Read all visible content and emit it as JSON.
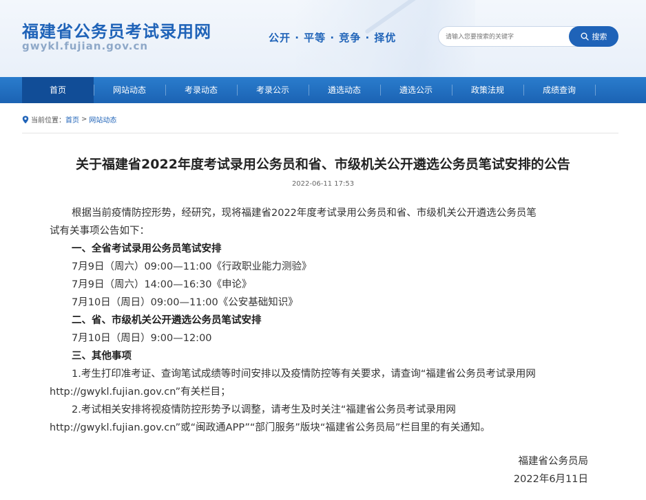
{
  "header": {
    "site_title": "福建省公务员考试录用网",
    "site_url": "gwykl.fujian.gov.cn",
    "slogan": "公开 · 平等 · 竞争 · 择优",
    "search": {
      "placeholder": "请输入您要搜索的关键字",
      "button_label": "搜索"
    }
  },
  "nav": {
    "items": [
      {
        "label": "首页",
        "active": true
      },
      {
        "label": "网站动态"
      },
      {
        "label": "考录动态"
      },
      {
        "label": "考录公示"
      },
      {
        "label": "遴选动态"
      },
      {
        "label": "遴选公示"
      },
      {
        "label": "政策法规"
      },
      {
        "label": "成绩查询"
      }
    ]
  },
  "breadcrumb": {
    "prefix": "当前位置：",
    "home": "首页",
    "separator": ">",
    "current": "网站动态"
  },
  "article": {
    "title": "关于福建省2022年度考试录用公务员和省、市级机关公开遴选公务员笔试安排的公告",
    "date": "2022-06-11 17:53",
    "intro_line1": "根据当前疫情防控形势，经研究，现将福建省2022年度考试录用公务员和省、市级机关公开遴选公务员笔",
    "intro_line2": "试有关事项公告如下：",
    "section1_heading": "一、全省考试录用公务员笔试安排",
    "section1_items": [
      "7月9日（周六）09:00—11:00《行政职业能力测验》",
      "7月9日（周六）14:00—16:30《申论》",
      "7月10日（周日）09:00—11:00《公安基础知识》"
    ],
    "section2_heading": "二、省、市级机关公开遴选公务员笔试安排",
    "section2_items": [
      "7月10日（周日）9:00—12:00"
    ],
    "section3_heading": "三、其他事项",
    "note1_line1": "1.考生打印准考证、查询笔试成绩等时间安排以及疫情防控等有关要求，请查询“福建省公务员考试录用网",
    "note1_line2": "http://gwykl.fujian.gov.cn”有关栏目；",
    "note2_line1": "2.考试相关安排将视疫情防控形势予以调整，请考生及时关注“福建省公务员考试录用网",
    "note2_line2": "http://gwykl.fujian.gov.cn”或“闽政通APP”“部门服务”版块“福建省公务员局”栏目里的有关通知。",
    "signature": "福建省公务员局",
    "sign_date": "2022年6月11日"
  },
  "colors": {
    "brand": "#1f63b8",
    "nav": "#1b63b3",
    "nav_active": "#114d97"
  }
}
